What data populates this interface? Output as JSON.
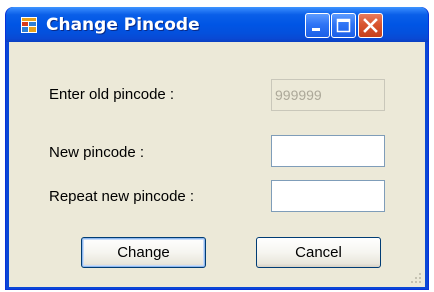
{
  "window": {
    "title": "Change Pincode",
    "icon": "window-app-icon"
  },
  "title_buttons": {
    "minimize": "minimize-icon",
    "maximize": "maximize-icon",
    "close": "close-icon"
  },
  "form": {
    "old_pincode_label": "Enter old pincode :",
    "old_pincode_value": "999999",
    "new_pincode_label": "New pincode :",
    "new_pincode_value": "",
    "repeat_pincode_label": "Repeat new pincode :",
    "repeat_pincode_value": ""
  },
  "buttons": {
    "change_label": "Change",
    "cancel_label": "Cancel"
  },
  "colors": {
    "titlebar": "#0055e5",
    "client_bg": "#ece9d8",
    "close_button": "#d9552f"
  }
}
